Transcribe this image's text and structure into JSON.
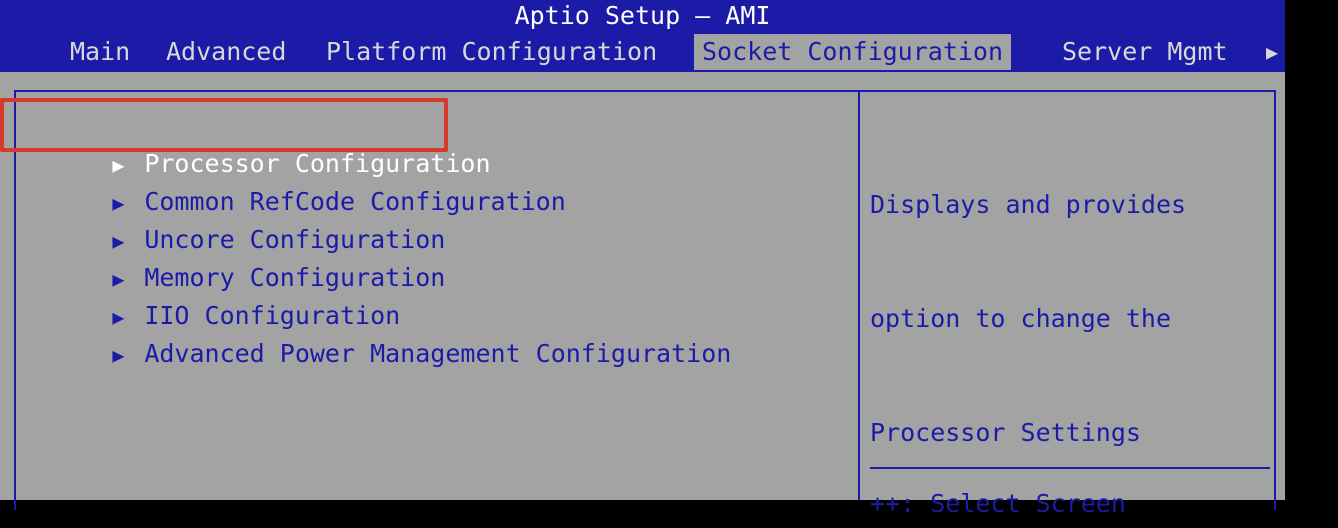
{
  "app": {
    "title": "Aptio Setup – AMI"
  },
  "tabs": [
    {
      "label": "Main"
    },
    {
      "label": "Advanced"
    },
    {
      "label": "Platform Configuration"
    },
    {
      "label": "Socket Configuration"
    },
    {
      "label": "Server Mgmt"
    }
  ],
  "active_tab": "Socket Configuration",
  "tab_more_glyph": "▶",
  "menu": {
    "arrow_glyph": "▶",
    "items": [
      {
        "label": "Processor Configuration"
      },
      {
        "label": "Common RefCode Configuration"
      },
      {
        "label": "Uncore Configuration"
      },
      {
        "label": "Memory Configuration"
      },
      {
        "label": "IIO Configuration"
      },
      {
        "label": "Advanced Power Management Configuration"
      }
    ],
    "selected_item": "Processor Configuration"
  },
  "help": {
    "lines": [
      "Displays and provides",
      "option to change the",
      "Processor Settings"
    ],
    "cut_off_line": "++: Select Screen"
  },
  "colors": {
    "bios_blue": "#1b1ba8",
    "panel_gray": "#a3a3a3",
    "highlight_red": "#d63a2a",
    "selected_text": "#ffffff"
  }
}
